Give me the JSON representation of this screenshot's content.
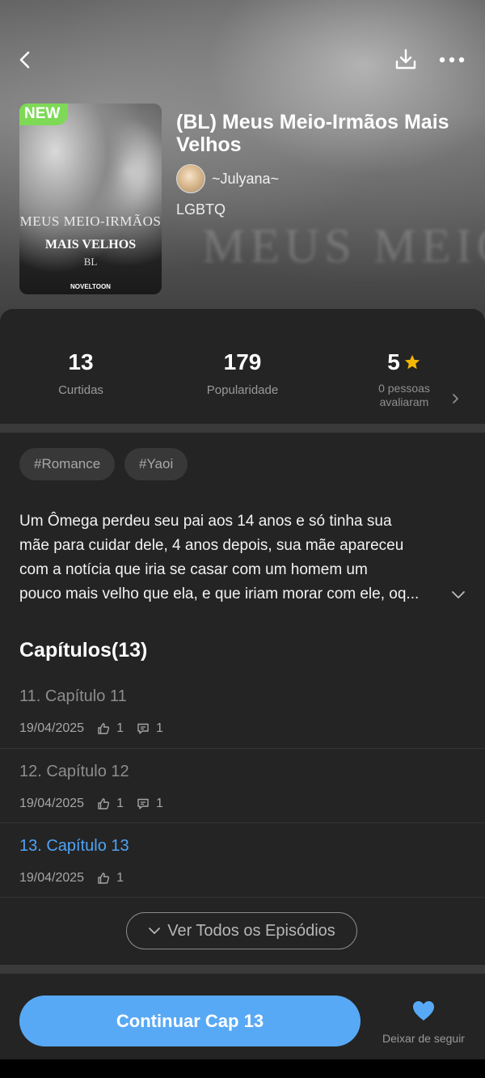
{
  "header": {
    "back_icon": "chevron-left-icon",
    "download_icon": "download-icon",
    "more_icon": "more-dots-icon",
    "background_text": "MEUS MEIO IRMAOS"
  },
  "book": {
    "badge": "NEW",
    "cover_title_line1": "MEUS MEIO-IRMÃOS",
    "cover_title_line2": "MAIS VELHOS",
    "cover_title_line3": "BL",
    "cover_brand": "NOVELTOON",
    "title": "(BL) Meus Meio-Irmãos Mais Velhos",
    "author": "~Julyana~",
    "genre": "LGBTQ"
  },
  "stats": {
    "likes_value": "13",
    "likes_label": "Curtidas",
    "popularity_value": "179",
    "popularity_label": "Popularidade",
    "rating_value": "5",
    "rating_label_line1": "0 pessoas",
    "rating_label_line2": "avaliaram"
  },
  "tags": [
    "#Romance",
    "#Yaoi"
  ],
  "synopsis": [
    "Um Ômega perdeu seu pai aos 14 anos e só tinha sua",
    "mãe para cuidar dele, 4 anos depois, sua mãe apareceu",
    "com a notícia que iria se casar com um homem um",
    "pouco mais velho que ela, e que iriam morar com ele, oq..."
  ],
  "chapters": {
    "heading": "Capítulos(13)",
    "items": [
      {
        "title": "11. Capítulo 11",
        "date": "19/04/2025",
        "likes": "1",
        "comments": "1"
      },
      {
        "title": "12. Capítulo 12",
        "date": "19/04/2025",
        "likes": "1",
        "comments": "1"
      },
      {
        "title": "13. Capítulo 13",
        "date": "19/04/2025",
        "likes": "1"
      }
    ],
    "view_all_label": "Ver Todos os Episódios"
  },
  "bottom": {
    "continue_label": "Continuar Cap 13",
    "follow_label": "Deixar de seguir"
  },
  "colors": {
    "accent": "#58a9f5",
    "current_chapter": "#4fa3f5",
    "badge": "#7ed957",
    "star": "#f5b800"
  }
}
